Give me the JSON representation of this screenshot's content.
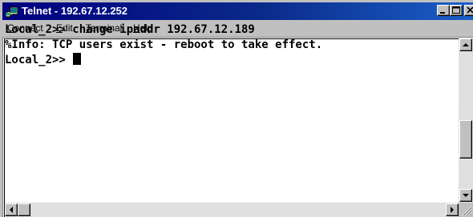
{
  "window": {
    "title": "Telnet - 192.67.12.252"
  },
  "menu": [
    {
      "label": "Connect",
      "accel": "C",
      "rest": "onnect"
    },
    {
      "label": "Edit",
      "accel": "E",
      "rest": "dit"
    },
    {
      "label": "Terminal",
      "accel": "T",
      "rest": "erminal"
    },
    {
      "label": "Help",
      "accel": "H",
      "rest": "elp"
    }
  ],
  "terminal": {
    "lines": [
      "Local_2>> change ipaddr 192.67.12.189",
      "%Info: TCP users exist - reboot to take effect.",
      "Local_2>> "
    ]
  },
  "colors": {
    "titlebar_start": "#000080",
    "titlebar_end": "#1a5fc8",
    "chrome": "#c0c0c0",
    "terminal_bg": "#ffffff",
    "terminal_text": "#000000"
  },
  "icons": {
    "app": "telnet-app-icon",
    "minimize": "minimize-icon",
    "maximize": "maximize-icon",
    "close": "close-icon",
    "scroll_up": "triangle-up-icon",
    "scroll_down": "triangle-down-icon",
    "scroll_left": "triangle-left-icon",
    "scroll_right": "triangle-right-icon"
  }
}
